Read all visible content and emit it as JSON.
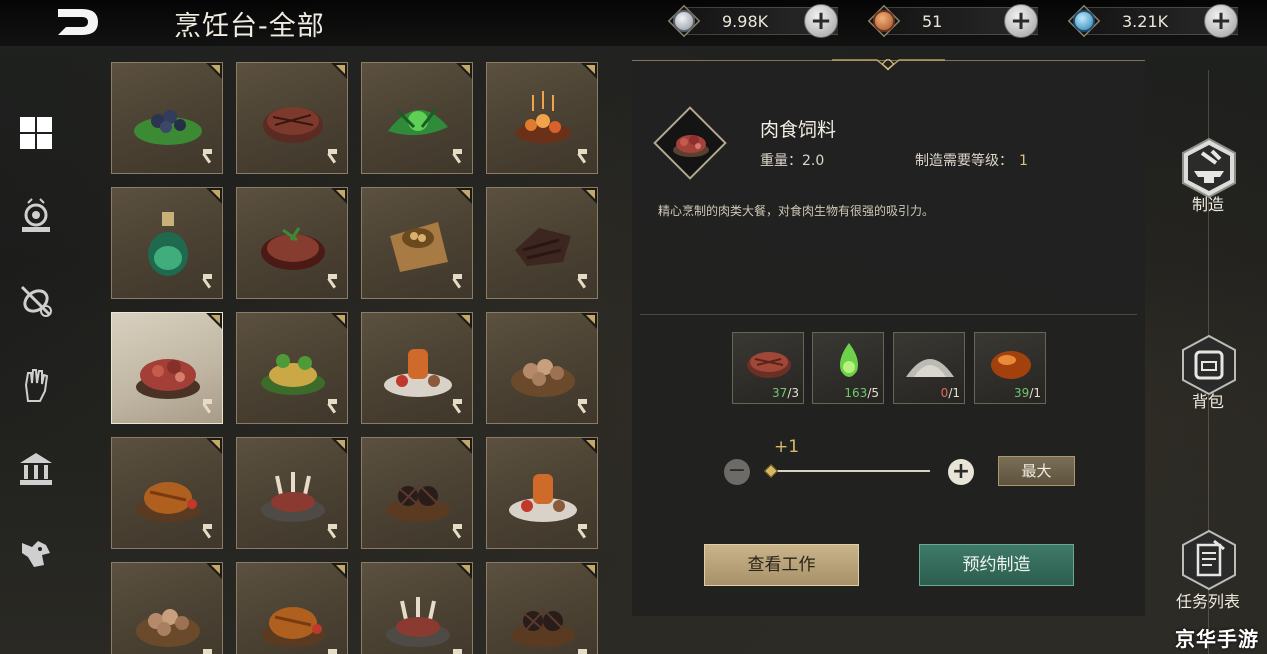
{
  "header": {
    "title": "烹饪台-全部",
    "currencies": [
      {
        "icon": "silver-coin-icon",
        "value": "9.98K",
        "color": "#b9c0c8"
      },
      {
        "icon": "copper-coin-icon",
        "value": "51",
        "color": "#c87a44"
      },
      {
        "icon": "blue-gem-icon",
        "value": "3.21K",
        "color": "#5fb0d8"
      }
    ]
  },
  "left_nav": [
    {
      "icon": "grid-all-icon",
      "active": true
    },
    {
      "icon": "cooking-pot-icon"
    },
    {
      "icon": "no-meat-icon"
    },
    {
      "icon": "hand-icon"
    },
    {
      "icon": "temple-icon"
    },
    {
      "icon": "creature-head-icon"
    }
  ],
  "grid": {
    "items": [
      {
        "kind": "berries"
      },
      {
        "kind": "steak"
      },
      {
        "kind": "herbs"
      },
      {
        "kind": "roasted-nuts"
      },
      {
        "kind": "potion"
      },
      {
        "kind": "garnished-steak"
      },
      {
        "kind": "seed-pouch"
      },
      {
        "kind": "jerky"
      },
      {
        "kind": "meat-feed",
        "selected": true
      },
      {
        "kind": "grain-salad"
      },
      {
        "kind": "sauce-platter"
      },
      {
        "kind": "egg-basket"
      },
      {
        "kind": "roast-chicken"
      },
      {
        "kind": "lamb-ribs"
      },
      {
        "kind": "urchin-dish"
      },
      {
        "kind": "sauce-platter"
      },
      {
        "kind": "egg-basket"
      },
      {
        "kind": "roast-chicken"
      },
      {
        "kind": "lamb-ribs"
      },
      {
        "kind": "urchin-dish"
      }
    ]
  },
  "detail": {
    "name": "肉食饲料",
    "weight": "重量：2.0",
    "level_label": "制造需要等级：",
    "level_value": "1",
    "description": "精心烹制的肉类大餐，对食肉生物有很强的吸引力。",
    "materials": [
      {
        "kind": "raw-meat",
        "have": "37",
        "need": "/3",
        "enough": true
      },
      {
        "kind": "green-extract",
        "have": "163",
        "need": "/5",
        "enough": true
      },
      {
        "kind": "salt-pile",
        "have": "0",
        "need": "/1",
        "enough": false
      },
      {
        "kind": "amber-sauce",
        "have": "39",
        "need": "/1",
        "enough": true
      }
    ],
    "quantity_delta": "+1",
    "max_label": "最大",
    "view_work_label": "查看工作",
    "reserve_craft_label": "预约制造"
  },
  "right_nav": [
    {
      "label": "制造",
      "icon": "anvil-hammer-icon",
      "active": true
    },
    {
      "label": "背包",
      "icon": "backpack-icon"
    },
    {
      "label": "任务列表",
      "icon": "scroll-list-icon"
    }
  ],
  "watermark": "京华手游"
}
